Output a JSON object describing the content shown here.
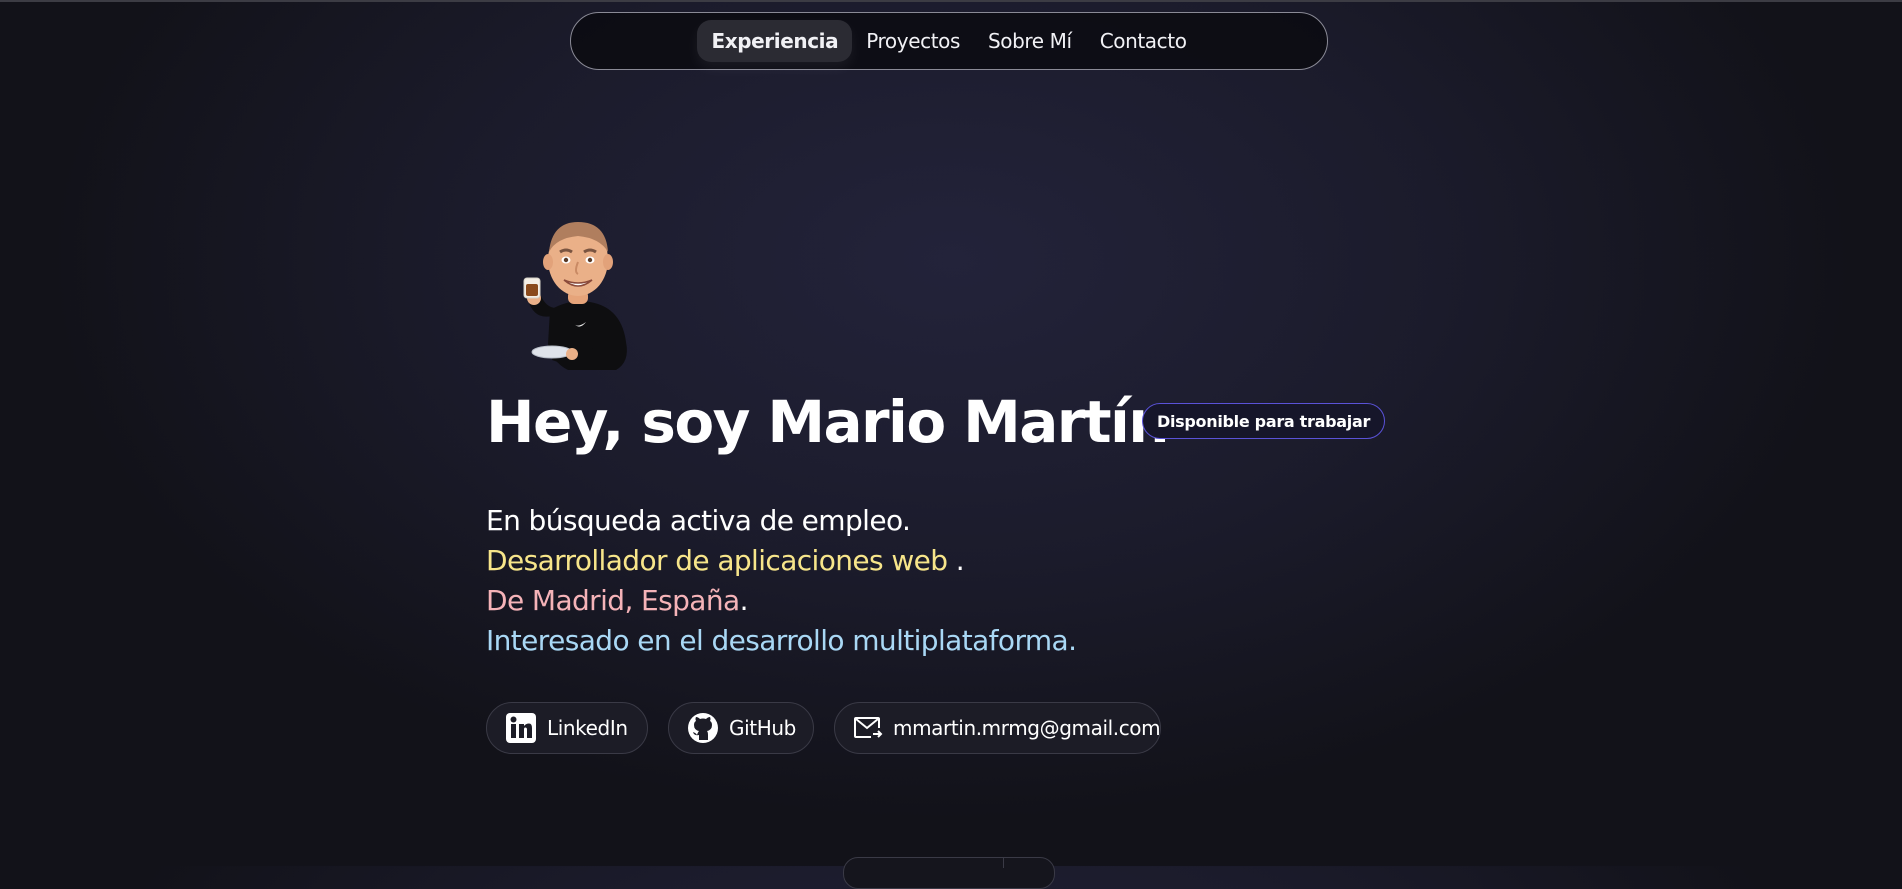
{
  "nav": {
    "items": [
      {
        "label": "Experiencia",
        "active": true
      },
      {
        "label": "Proyectos"
      },
      {
        "label": "Sobre Mí"
      },
      {
        "label": "Contacto"
      }
    ]
  },
  "hero": {
    "title": "Hey, soy Mario Martín",
    "badge": "Disponible para trabajar",
    "line1": "En búsqueda activa de empleo.",
    "line2_highlight": "Desarrollador de aplicaciones web",
    "line2_suffix": " .",
    "line3_highlight": "De Madrid, España",
    "line3_suffix": ".",
    "line4": "Interesado en el desarrollo multiplataforma."
  },
  "social": {
    "linkedin": {
      "label": "LinkedIn",
      "icon": "linkedin-icon"
    },
    "github": {
      "label": "GitHub",
      "icon": "github-icon"
    },
    "email": {
      "label": "mmartin.mrmg@gmail.com",
      "icon": "mail-icon"
    }
  },
  "colors": {
    "background": "#1b1b2b",
    "accent_yellow": "#f7e58a",
    "accent_pink": "#f5b3b8",
    "accent_blue": "#a9d8f5",
    "badge_border": "#5a52d8"
  }
}
